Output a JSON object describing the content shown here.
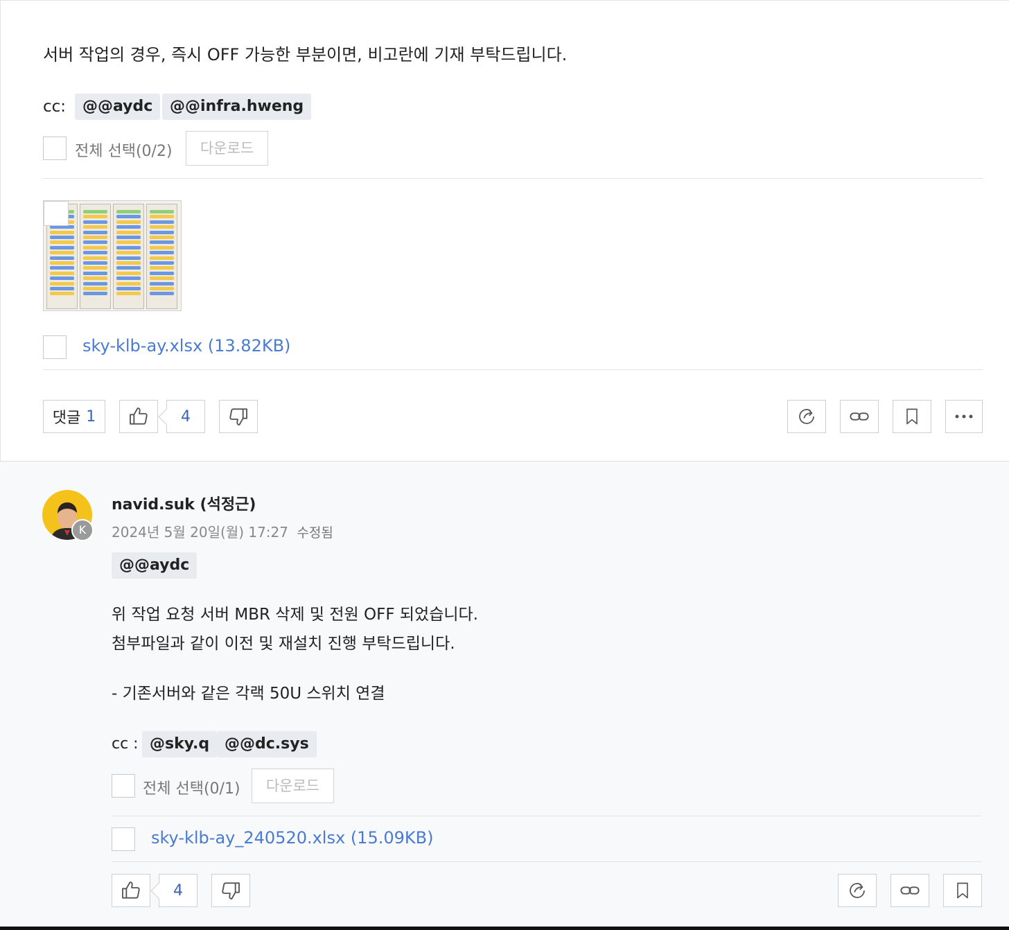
{
  "post": {
    "body_text": "서버 작업의 경우, 즉시 OFF 가능한 부분이면, 비고란에 기재 부탁드립니다.",
    "cc_label": "cc:",
    "mentions": [
      "@@aydc",
      "@@infra.hweng"
    ],
    "select_all_label": "전체 선택(0/2)",
    "download_label": "다운로드",
    "attachment": "sky-klb-ay.xlsx (13.82KB)",
    "actions": {
      "comment_label": "댓글",
      "comment_count": "1",
      "like_count": "4"
    }
  },
  "comment": {
    "author": "navid.suk (석정근)",
    "avatar_badge": "K",
    "timestamp": "2024년 5월 20일(월) 17:27",
    "edited_label": "수정됨",
    "mention": "@@aydc",
    "lines": [
      "위 작업 요청 서버 MBR 삭제 및 전원 OFF 되었습니다.",
      "첨부파일과 같이 이전 및 재설치 진행 부탁드립니다.",
      "- 기존서버와 같은 각랙 50U 스위치 연결"
    ],
    "cc_label": "cc :",
    "cc_mentions": [
      "@sky.q",
      "@@dc.sys"
    ],
    "select_all_label": "전체 선택(0/1)",
    "download_label": "다운로드",
    "attachment": "sky-klb-ay_240520.xlsx (15.09KB)",
    "like_count": "4"
  },
  "icons": [
    "like-icon",
    "dislike-icon",
    "share-icon",
    "link-icon",
    "bookmark-icon",
    "more-icon"
  ],
  "colors": {
    "link": "#4a7bd0",
    "count": "#3a64b6",
    "comment_bg": "#f7f9fb",
    "mention_bg": "#e8ebef"
  }
}
